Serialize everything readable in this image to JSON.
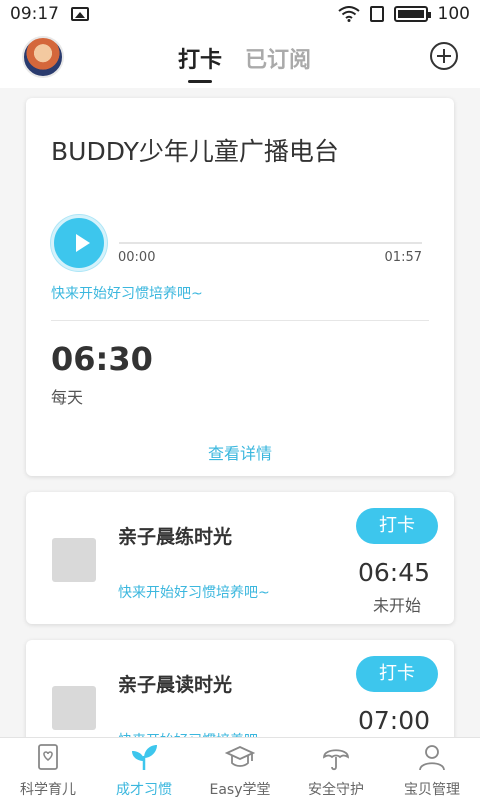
{
  "status_bar": {
    "time": "09:17",
    "battery": "100"
  },
  "header": {
    "tabs": [
      {
        "label": "打卡",
        "active": true
      },
      {
        "label": "已订阅",
        "active": false
      }
    ]
  },
  "radio_card": {
    "title": "BUDDY少年儿童广播电台",
    "time_elapsed": "00:00",
    "time_total": "01:57",
    "hint": "快来开始好习惯培养吧~",
    "schedule_time": "06:30",
    "frequency": "每天",
    "details_link": "查看详情"
  },
  "habits": [
    {
      "title": "亲子晨练时光",
      "hint": "快来开始好习惯培养吧~",
      "button": "打卡",
      "time": "06:45",
      "status": "未开始"
    },
    {
      "title": "亲子晨读时光",
      "hint": "快来开始好习惯培养吧~",
      "button": "打卡",
      "time": "07:00",
      "status": ""
    }
  ],
  "bottom_nav": {
    "items": [
      {
        "label": "科学育儿",
        "icon": "book-heart-icon",
        "active": false
      },
      {
        "label": "成才习惯",
        "icon": "sprout-icon",
        "active": true
      },
      {
        "label": "Easy学堂",
        "icon": "graduation-cap-icon",
        "active": false
      },
      {
        "label": "安全守护",
        "icon": "umbrella-icon",
        "active": false
      },
      {
        "label": "宝贝管理",
        "icon": "user-icon",
        "active": false
      }
    ]
  },
  "colors": {
    "accent": "#3dc6ed",
    "link": "#3bb7de"
  }
}
